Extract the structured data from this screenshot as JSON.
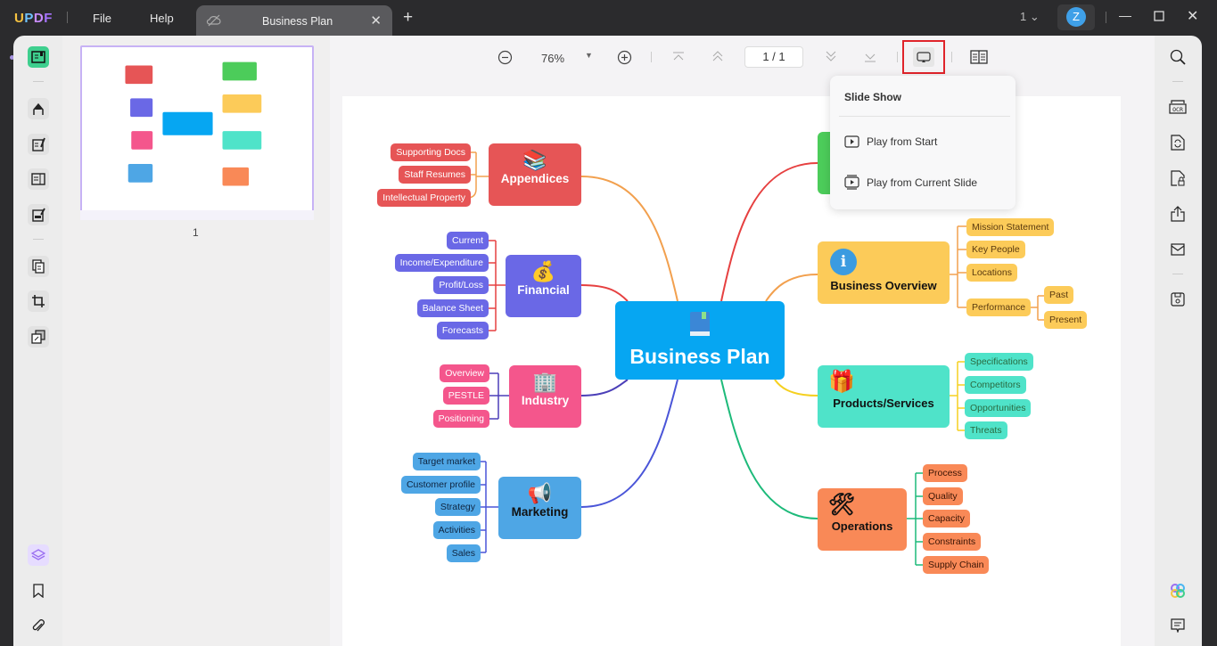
{
  "app": {
    "logo": [
      "U",
      "P",
      "D",
      "F"
    ],
    "menu": [
      "File",
      "Help"
    ],
    "tab_title": "Business Plan",
    "page_selector": "1",
    "avatar_letter": "Z"
  },
  "toolbar": {
    "zoom": "76%",
    "page_current": "1",
    "page_total": "1",
    "page_display": "1 / 1"
  },
  "slideshow_menu": {
    "title": "Slide Show",
    "items": [
      "Play from Start",
      "Play from Current Slide"
    ]
  },
  "thumbnail": {
    "page_number": "1"
  },
  "mindmap": {
    "center": "Business Plan",
    "branches": {
      "appendices": {
        "label": "Appendices",
        "color": "#e65556",
        "items": [
          "Supporting Docs",
          "Staff Resumes",
          "Intellectual Property"
        ]
      },
      "financial": {
        "label": "Financial",
        "color": "#6a68e6",
        "items": [
          "Current",
          "Income/Expenditure",
          "Profit/Loss",
          "Balance Sheet",
          "Forecasts"
        ]
      },
      "industry": {
        "label": "Industry",
        "color": "#f4568c",
        "items": [
          "Overview",
          "PESTLE",
          "Positioning"
        ]
      },
      "marketing": {
        "label": "Marketing",
        "color": "#4ea6e5",
        "items": [
          "Target market",
          "Customer profile",
          "Strategy",
          "Activities",
          "Sales"
        ]
      },
      "overview": {
        "label": "Business Overview",
        "color": "#fccb59",
        "items": [
          "Mission Statement",
          "Key People",
          "Locations",
          "Performance"
        ],
        "sub": [
          "Past",
          "Present"
        ]
      },
      "products": {
        "label": "Products/Services",
        "color": "#4fe3c9",
        "items": [
          "Specifications",
          "Competitors",
          "Opportunities",
          "Threats"
        ]
      },
      "operations": {
        "label": "Operations",
        "color": "#f98957",
        "items": [
          "Process",
          "Quality",
          "Capacity",
          "Constraints",
          "Supply Chain"
        ]
      }
    }
  }
}
